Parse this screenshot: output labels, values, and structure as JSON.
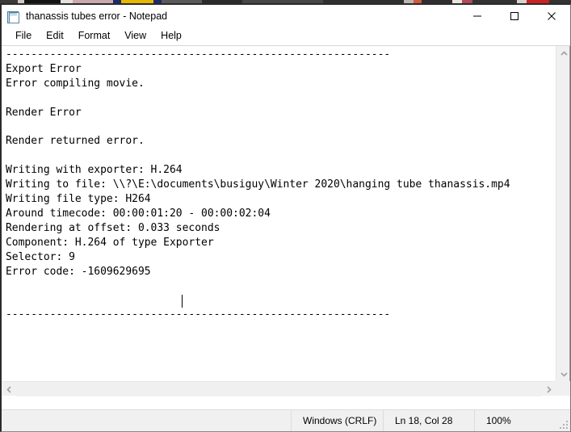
{
  "window": {
    "title": "thanassis tubes error - Notepad",
    "icon": "notepad-icon",
    "controls": {
      "minimize": "minimize-icon",
      "maximize": "maximize-icon",
      "close": "close-icon"
    }
  },
  "menubar": {
    "items": [
      {
        "label": "File"
      },
      {
        "label": "Edit"
      },
      {
        "label": "Format"
      },
      {
        "label": "View"
      },
      {
        "label": "Help"
      }
    ]
  },
  "editor": {
    "text": "-------------------------------------------------------------\nExport Error\nError compiling movie.\n\nRender Error\n\nRender returned error.\n\nWriting with exporter: H.264\nWriting to file: \\\\?\\E:\\documents\\busiguy\\Winter 2020\\hanging tube thanassis.mp4\nWriting file type: H264\nAround timecode: 00:00:01:20 - 00:00:02:04\nRendering at offset: 0.033 seconds\nComponent: H.264 of type Exporter\nSelector: 9\nError code: -1609629695\n\n\n-------------------------------------------------------------",
    "lines": [
      "-------------------------------------------------------------",
      "Export Error",
      "Error compiling movie.",
      "",
      "Render Error",
      "",
      "Render returned error.",
      "",
      "Writing with exporter: H.264",
      "Writing to file: \\\\?\\E:\\documents\\busiguy\\Winter 2020\\hanging tube thanassis.mp4",
      "Writing file type: H264",
      "Around timecode: 00:00:01:20 - 00:00:02:04",
      "Rendering at offset: 0.033 seconds",
      "Component: H.264 of type Exporter",
      "Selector: 9",
      "Error code: -1609629695",
      "",
      "",
      "-------------------------------------------------------------"
    ],
    "caret": {
      "line": 18,
      "column": 28
    }
  },
  "scrollbars": {
    "vertical": {
      "up": "scroll-up-icon",
      "down": "scroll-down-icon"
    },
    "horizontal": {
      "left": "scroll-left-icon",
      "right": "scroll-right-icon"
    }
  },
  "statusbar": {
    "encoding": "Windows (CRLF)",
    "position": "Ln 18, Col 28",
    "zoom": "100%"
  },
  "colors": {
    "window_bg": "#ffffff",
    "text": "#000000",
    "statusbar_bg": "#f0f0f0",
    "scrollbar_bg": "#f0f0f0",
    "border": "#2b2b2b"
  }
}
